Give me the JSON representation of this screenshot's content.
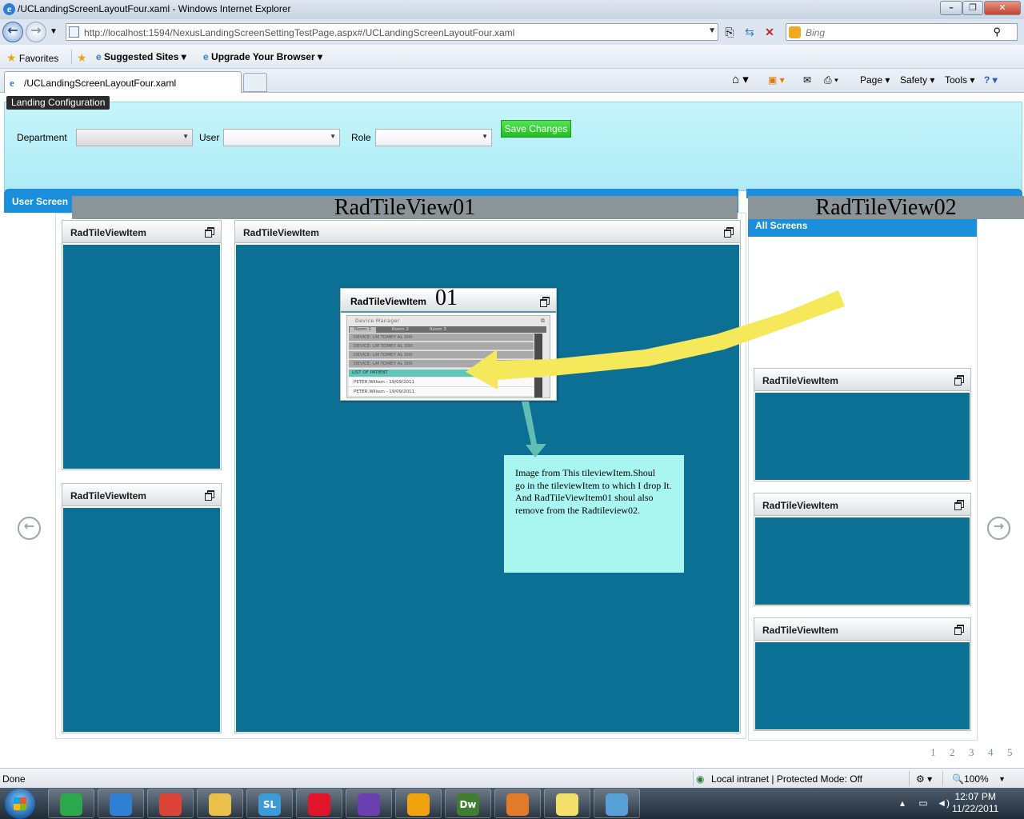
{
  "browser": {
    "window_title": "/UCLandingScreenLayoutFour.xaml - Windows Internet Explorer",
    "address": "http://localhost:1594/NexusLandingScreenSettingTestPage.aspx#/UCLandingScreenLayoutFour.xaml",
    "search_placeholder": "Bing",
    "favorites": {
      "favorites_label": "Favorites",
      "suggested_sites": "Suggested Sites ▾",
      "upgrade_browser": "Upgrade Your Browser ▾"
    },
    "tab_title": "/UCLandingScreenLayoutFour.xaml",
    "commands": {
      "page": "Page ▾",
      "safety": "Safety ▾",
      "tools": "Tools ▾"
    }
  },
  "config": {
    "header": "Landing Configuration",
    "department_label": "Department",
    "department_value": "",
    "user_label": "User",
    "user_value": "",
    "role_label": "Role",
    "role_value": "",
    "save_button": "Save Changes"
  },
  "user_screens": {
    "header": "User Screen",
    "annotation": "RadTileView01",
    "tiles": [
      {
        "title": "RadTileViewItem"
      },
      {
        "title": "RadTileViewItem"
      },
      {
        "title": "RadTileViewItem"
      }
    ]
  },
  "all_screens": {
    "header": "All Screens",
    "annotation": "RadTileView02",
    "tiles": [
      {
        "title": "RadTileViewItem"
      },
      {
        "title": "RadTileViewItem"
      },
      {
        "title": "RadTileViewItem"
      }
    ]
  },
  "dragged_item": {
    "title": "RadTileViewItem",
    "suffix": "01",
    "thumbnail": {
      "title": "Device Manager",
      "tabs": [
        "Room 1",
        "Room 2",
        "Room 3"
      ],
      "devices": [
        "DEVICE:    LM TOMEY AL 300",
        "DEVICE:    LM TOMEY AL 300",
        "DEVICE:    LM TOMEY AL 300",
        "DEVICE:    LM TOMEY AL 300"
      ],
      "list_header": "LIST OF PATIENT",
      "patients": [
        "PETER,Willson  -     19/09/2011",
        "PETER,Willson  -     19/09/2011"
      ]
    }
  },
  "note": {
    "lines": [
      "Image from This tileviewItem.Shoul",
      "go in the tileviewItem to which I drop It.",
      "And RadTileViewItem01 shoul also",
      "remove from the Radtileview02."
    ]
  },
  "pager": {
    "pages": [
      "1",
      "2",
      "3",
      "4",
      "5"
    ]
  },
  "status": {
    "left": "Done",
    "zone": "Local intranet | Protected Mode: Off",
    "zoom": "100%"
  },
  "taskbar": {
    "time": "12:07 PM",
    "date": "11/22/2011",
    "apps": [
      {
        "icon": "quill-icon",
        "color": "#2aa84a"
      },
      {
        "icon": "ie-icon",
        "color": "#2f7fd4"
      },
      {
        "icon": "chrome-icon",
        "color": "#db4437"
      },
      {
        "icon": "folder-icon",
        "color": "#e8c04a"
      },
      {
        "icon": "silverlight-icon",
        "color": "#3a9bd6",
        "label": "SL"
      },
      {
        "icon": "opera-icon",
        "color": "#e0142b"
      },
      {
        "icon": "visual-studio-icon",
        "color": "#6b3fb0"
      },
      {
        "icon": "picasa-icon",
        "color": "#f2a20c"
      },
      {
        "icon": "dreamweaver-icon",
        "color": "#3d7f2f",
        "label": "Dw"
      },
      {
        "icon": "tools-icon",
        "color": "#e07b2a"
      },
      {
        "icon": "sticky-notes-icon",
        "color": "#f3e06a"
      },
      {
        "icon": "remote-desktop-icon",
        "color": "#5aa0d8"
      }
    ]
  },
  "colors": {
    "tile_body": "#0c7094",
    "accent_blue": "#1c8fdc",
    "config_bg": "#bdf2f8",
    "save_green": "#1fbe1f",
    "note_bg": "#a9f5ef",
    "arrow_yellow": "#f5e85a",
    "arrow_teal": "#62bdb2"
  }
}
